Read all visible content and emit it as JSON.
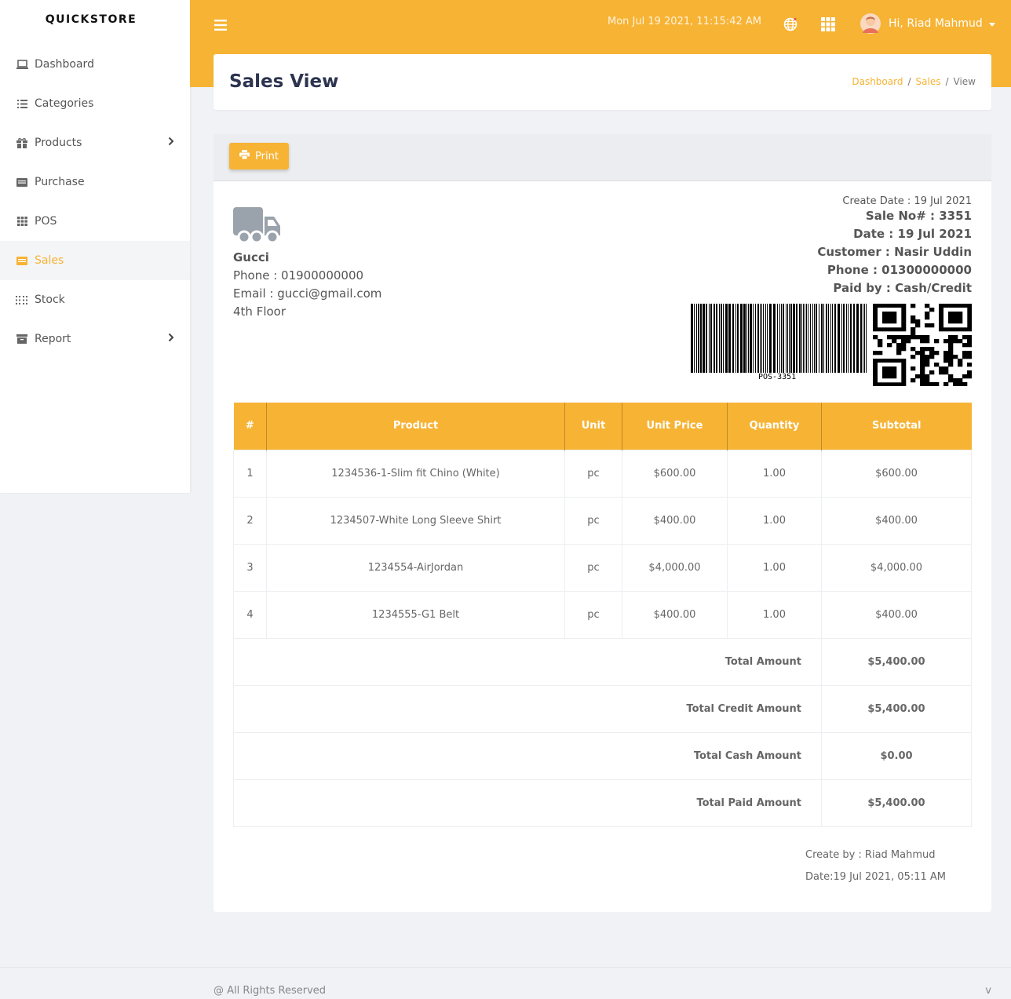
{
  "brand": "QUICKSTORE",
  "sidebar": {
    "items": [
      {
        "label": "Dashboard",
        "icon": "laptop-icon"
      },
      {
        "label": "Categories",
        "icon": "list-icon"
      },
      {
        "label": "Products",
        "icon": "gift-icon",
        "has_submenu": true
      },
      {
        "label": "Purchase",
        "icon": "card-icon"
      },
      {
        "label": "POS",
        "icon": "th-icon"
      },
      {
        "label": "Sales",
        "icon": "money-icon",
        "active": true
      },
      {
        "label": "Stock",
        "icon": "dots-grid-icon"
      },
      {
        "label": "Report",
        "icon": "archive-icon",
        "has_submenu": true
      }
    ]
  },
  "topbar": {
    "datetime": "Mon Jul 19 2021, 11:15:42 AM",
    "user_greeting": "Hi, Riad Mahmud"
  },
  "page": {
    "title": "Sales View",
    "breadcrumb": [
      "Dashboard",
      "Sales",
      "View"
    ],
    "breadcrumb_sep": "/"
  },
  "toolbar": {
    "print_label": "Print"
  },
  "company": {
    "name": "Gucci",
    "phone": "Phone : 01900000000",
    "email": "Email : gucci@gmail.com",
    "address": "4th Floor"
  },
  "sale_info": {
    "create_date": "Create Date : 19 Jul 2021",
    "sale_no": "Sale No# : 3351",
    "date": "Date : 19 Jul 2021",
    "customer": "Customer : Nasir Uddin",
    "phone": "Phone : 01300000000",
    "paid_by": "Paid by : Cash/Credit",
    "barcode_text": "POS-3351"
  },
  "table": {
    "headers": [
      "#",
      "Product",
      "Unit",
      "Unit Price",
      "Quantity",
      "Subtotal"
    ],
    "rows": [
      [
        "1",
        "1234536-1-Slim fit Chino (White)",
        "pc",
        "$600.00",
        "1.00",
        "$600.00"
      ],
      [
        "2",
        "1234507-White Long Sleeve Shirt",
        "pc",
        "$400.00",
        "1.00",
        "$400.00"
      ],
      [
        "3",
        "1234554-AirJordan",
        "pc",
        "$4,000.00",
        "1.00",
        "$4,000.00"
      ],
      [
        "4",
        "1234555-G1 Belt",
        "pc",
        "$400.00",
        "1.00",
        "$400.00"
      ]
    ],
    "totals": [
      {
        "label": "Total Amount",
        "value": "$5,400.00"
      },
      {
        "label": "Total Credit Amount",
        "value": "$5,400.00"
      },
      {
        "label": "Total Cash Amount",
        "value": "$0.00"
      },
      {
        "label": "Total Paid Amount",
        "value": "$5,400.00"
      }
    ]
  },
  "footer_info": {
    "created_by": "Create by : Riad Mahmud",
    "created_date": "Date:19 Jul 2021, 05:11 AM"
  },
  "page_footer": {
    "rights": "@ All Rights Reserved",
    "version": "v"
  },
  "colors": {
    "accent": "#f7b334",
    "title": "#2d3450"
  }
}
